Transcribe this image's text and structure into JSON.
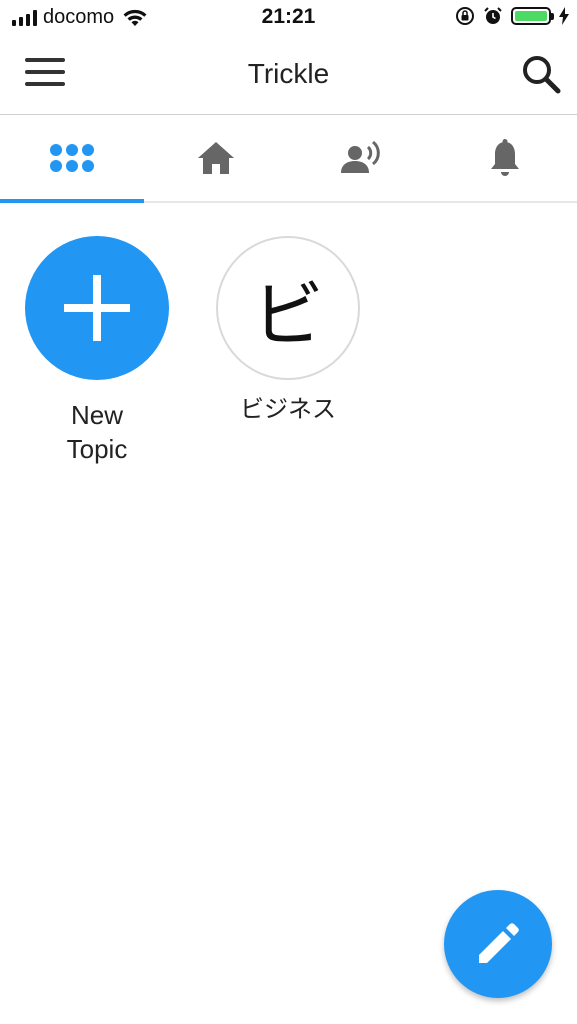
{
  "status_bar": {
    "carrier": "docomo",
    "time": "21:21",
    "battery_level": 1.0,
    "icons": [
      "signal-icon",
      "wifi-icon",
      "orientation-lock-icon",
      "alarm-icon",
      "battery-icon",
      "charging-icon"
    ]
  },
  "header": {
    "title": "Trickle",
    "menu_icon": "hamburger-menu-icon",
    "search_icon": "search-icon"
  },
  "tabs": [
    {
      "icon": "grid-dots-icon",
      "active": true
    },
    {
      "icon": "home-icon",
      "active": false
    },
    {
      "icon": "person-speaking-icon",
      "active": false
    },
    {
      "icon": "bell-icon",
      "active": false
    }
  ],
  "topics": {
    "new": {
      "label": "New\nTopic",
      "label_line1": "New",
      "label_line2": "Topic",
      "icon": "plus-icon"
    },
    "items": [
      {
        "letter": "ビ",
        "label": "ビジネス"
      }
    ]
  },
  "fab": {
    "icon": "pencil-icon"
  },
  "colors": {
    "accent": "#2196F3",
    "battery": "#4cd964",
    "icon_gray": "#666666"
  }
}
